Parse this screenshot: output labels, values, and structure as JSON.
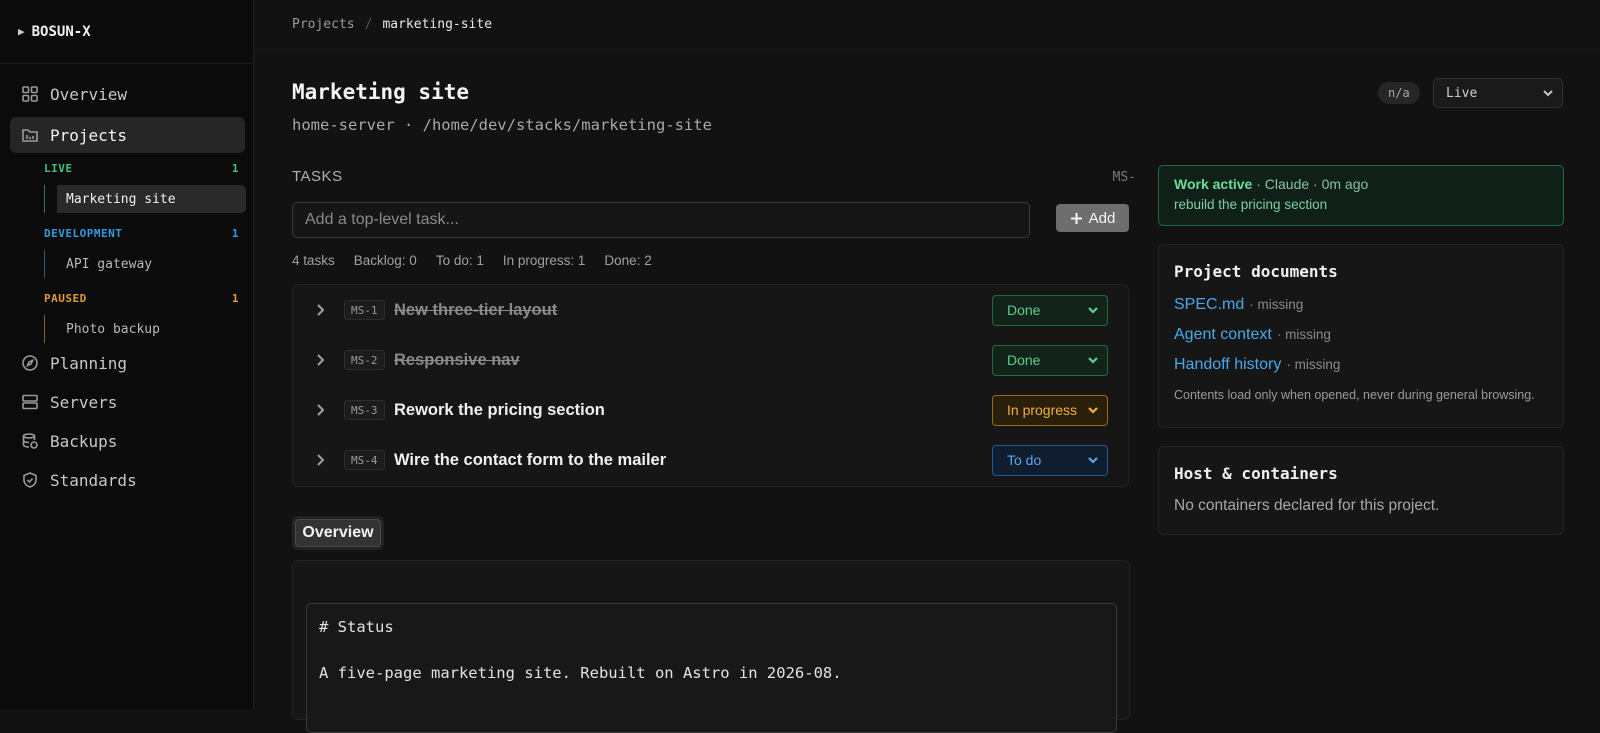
{
  "app": {
    "brand": "BOSUN-X"
  },
  "sidebar": {
    "nav": [
      {
        "label": "Overview",
        "icon": "grid-icon"
      },
      {
        "label": "Projects",
        "icon": "folder-icon"
      },
      {
        "label": "Planning",
        "icon": "compass-icon"
      },
      {
        "label": "Servers",
        "icon": "server-icon"
      },
      {
        "label": "Backups",
        "icon": "database-icon"
      },
      {
        "label": "Standards",
        "icon": "shield-icon"
      }
    ],
    "groups": [
      {
        "label": "LIVE",
        "count": "1",
        "color": "#3fc27a",
        "items": [
          "Marketing site"
        ]
      },
      {
        "label": "DEVELOPMENT",
        "count": "1",
        "color": "#2f9be0",
        "items": [
          "API gateway"
        ]
      },
      {
        "label": "PAUSED",
        "count": "1",
        "color": "#e09a2f",
        "items": [
          "Photo backup"
        ]
      }
    ]
  },
  "breadcrumb": {
    "parent": "Projects",
    "sep": "/",
    "current": "marketing-site"
  },
  "project": {
    "title": "Marketing site",
    "subtitle": "home-server · /home/dev/stacks/marketing-site",
    "badge": "n/a",
    "state": "Live"
  },
  "tasks": {
    "heading": "TASKS",
    "prefix": "MS-",
    "input_placeholder": "Add a top-level task...",
    "add_label": "Add",
    "stats": [
      "4 tasks",
      "Backlog: 0",
      "To do: 1",
      "In progress: 1",
      "Done: 2"
    ],
    "items": [
      {
        "id": "MS-1",
        "title": "New three-tier layout",
        "status": "Done"
      },
      {
        "id": "MS-2",
        "title": "Responsive nav",
        "status": "Done"
      },
      {
        "id": "MS-3",
        "title": "Rework the pricing section",
        "status": "In progress"
      },
      {
        "id": "MS-4",
        "title": "Wire the contact form to the mailer",
        "status": "To do"
      }
    ]
  },
  "tabs": {
    "overview": "Overview"
  },
  "overview_doc": {
    "line1": "# Status",
    "line2": "A five-page marketing site. Rebuilt on Astro in 2026-08."
  },
  "work": {
    "label": "Work active",
    "meta": "· Claude · 0m ago",
    "detail": "rebuild the pricing section"
  },
  "documents": {
    "title": "Project documents",
    "items": [
      {
        "name": "SPEC.md",
        "state": "· missing"
      },
      {
        "name": "Agent context",
        "state": "· missing"
      },
      {
        "name": "Handoff history",
        "state": "· missing"
      }
    ],
    "note": "Contents load only when opened, never during general browsing."
  },
  "host": {
    "title": "Host & containers",
    "empty": "No containers declared for this project."
  }
}
